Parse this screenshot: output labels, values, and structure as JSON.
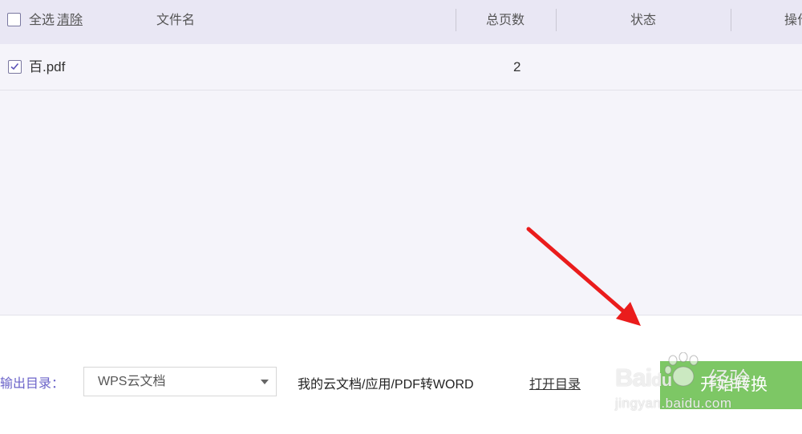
{
  "table": {
    "select_all_label": "全选",
    "clear_label": "清除",
    "columns": {
      "filename": "文件名",
      "pages": "总页数",
      "status": "状态",
      "actions": "操作"
    },
    "rows": [
      {
        "checked": true,
        "filename": "百.pdf",
        "pages": "2",
        "status": ""
      }
    ]
  },
  "footer": {
    "output_label": "输出目录：",
    "directory_select": "WPS云文档",
    "path": "我的云文档/应用/PDF转WORD",
    "open_dir": "打开目录",
    "start_button": "开始转换"
  },
  "watermark": {
    "logo_bai": "Bai",
    "logo_du": "du",
    "brand": "经验",
    "url": "jingyan.baidu.com"
  },
  "colors": {
    "header_bg": "#e9e7f4",
    "list_bg": "#f5f4fa",
    "accent_label": "#6b63c9",
    "start_button": "#7dc765",
    "annotation_arrow": "#ea1c1c"
  },
  "icons": {
    "row_checkbox": "checkbox-checked-icon",
    "header_checkbox": "checkbox-icon",
    "select_caret": "chevron-down-icon",
    "annotation": "red-arrow-icon"
  }
}
